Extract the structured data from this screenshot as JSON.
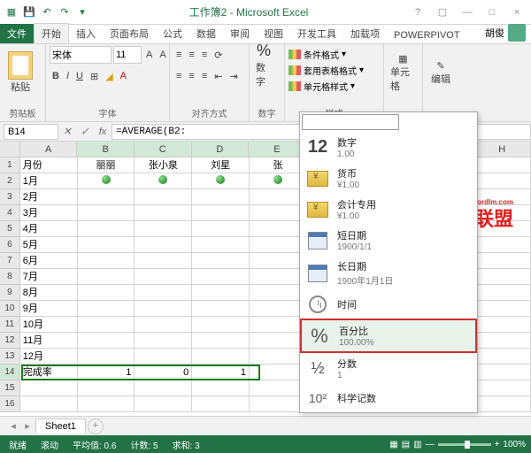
{
  "title": "工作簿2 - Microsoft Excel",
  "tabs": {
    "file": "文件",
    "home": "开始",
    "insert": "插入",
    "layout": "页面布局",
    "formulas": "公式",
    "data": "数据",
    "review": "审阅",
    "view": "视图",
    "dev": "开发工具",
    "addins": "加载项",
    "powerpivot": "POWERPIVOT",
    "user": "胡俊"
  },
  "ribbon": {
    "paste": "粘贴",
    "clipboard_label": "剪贴板",
    "font_name": "宋体",
    "font_size": "11",
    "font_label": "字体",
    "align_label": "对齐方式",
    "number": "数字",
    "number_label": "数字",
    "cond_format": "条件格式",
    "table_format": "套用表格格式",
    "cell_styles": "单元格样式",
    "styles_label": "样式",
    "cells": "单元格",
    "editing": "编辑"
  },
  "namebox": "B14",
  "formula": "=AVERAGE(B2:",
  "columns": [
    "A",
    "B",
    "C",
    "D",
    "E",
    "H"
  ],
  "rows": [
    "1",
    "2",
    "3",
    "4",
    "5",
    "6",
    "7",
    "8",
    "9",
    "10",
    "11",
    "12",
    "13",
    "14",
    "15",
    "16"
  ],
  "headers": {
    "a": "月份",
    "b": "丽丽",
    "c": "张小泉",
    "d": "刘星",
    "e": "张"
  },
  "months": [
    "1月",
    "2月",
    "3月",
    "4月",
    "5月",
    "6月",
    "7月",
    "8月",
    "9月",
    "10月",
    "11月",
    "12月"
  ],
  "row14": {
    "label": "完成率",
    "b": "1",
    "c": "0",
    "d": "1"
  },
  "dropdown": {
    "input": "",
    "items": [
      {
        "icon": "12",
        "label": "数字",
        "sample": "1.00"
      },
      {
        "icon": "money",
        "label": "货币",
        "sample": "¥1.00"
      },
      {
        "icon": "money",
        "label": "会计专用",
        "sample": "¥1.00"
      },
      {
        "icon": "cal",
        "label": "短日期",
        "sample": "1900/1/1"
      },
      {
        "icon": "cal",
        "label": "长日期",
        "sample": "1900年1月1日"
      },
      {
        "icon": "clock",
        "label": "时间",
        "sample": ""
      },
      {
        "icon": "pct",
        "label": "百分比",
        "sample": "100.00%"
      },
      {
        "icon": "frac",
        "label": "分数",
        "sample": "1"
      },
      {
        "icon": "sci",
        "label": "科学记数",
        "sample": ""
      }
    ]
  },
  "watermark": {
    "url": "www.wordlm.com",
    "text_cn": "联盟"
  },
  "sheets": {
    "sheet1": "Sheet1"
  },
  "statusbar": {
    "ready": "就绪",
    "scroll": "滚动",
    "avg": "平均值: 0.6",
    "count": "计数: 5",
    "sum": "求和: 3",
    "zoom": "100%"
  },
  "chart_data": null
}
